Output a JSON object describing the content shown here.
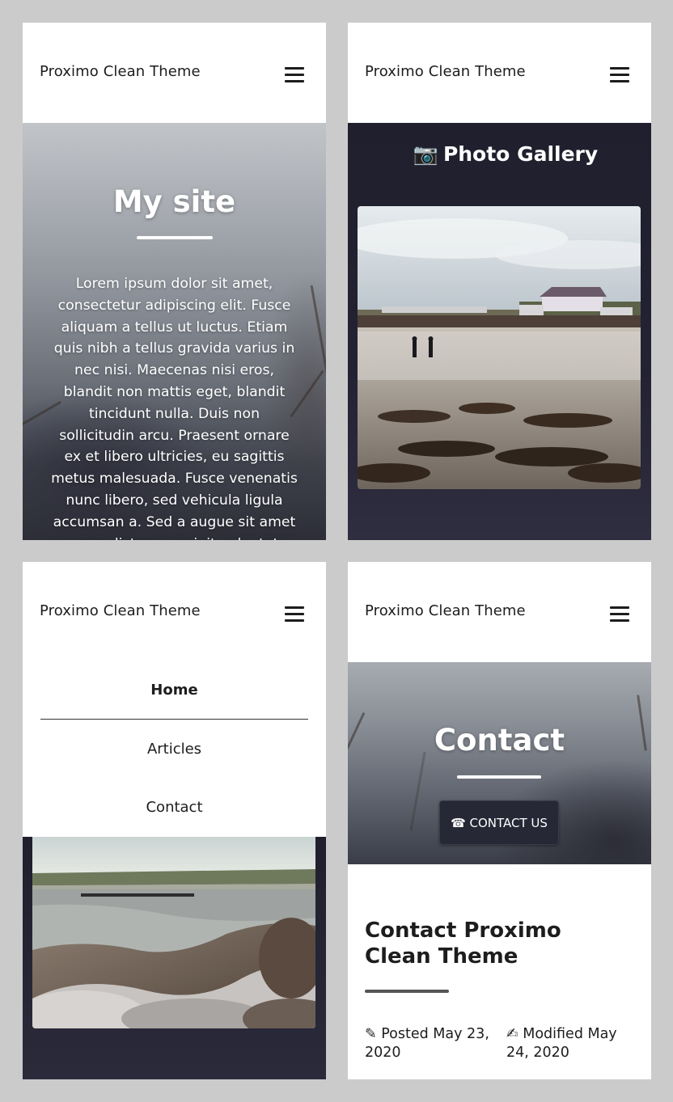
{
  "brand": "Proximo Clean Theme",
  "hero": {
    "title": "My site",
    "body": "Lorem ipsum dolor sit amet, consectetur adipiscing elit. Fusce aliquam a tellus ut luctus. Etiam quis nibh a tellus gravida varius in nec nisi. Maecenas nisi eros, blandit non mattis eget, blandit tincidunt nulla. Duis non sollicitudin arcu. Praesent ornare ex et libero ultricies, eu sagittis metus malesuada. Fusce venenatis nunc libero, sed vehicula ligula accumsan a. Sed a augue sit amet neque dictum suscipit vulputate"
  },
  "gallery": {
    "icon": "camera-icon",
    "camera_glyph": "📷",
    "title": "Photo Gallery"
  },
  "nav": {
    "items": [
      {
        "label": "Home",
        "active": true
      },
      {
        "label": "Articles",
        "active": false
      },
      {
        "label": "Contact",
        "active": false
      }
    ]
  },
  "contact": {
    "title": "Contact",
    "button_icon": "telephone-icon",
    "button_glyph": "☎",
    "button_label": "CONTACT US"
  },
  "article": {
    "title": "Contact Proximo Clean Theme",
    "posted_icon": "pencil-icon",
    "posted_glyph": "✎",
    "posted": "Posted May 23, 2020",
    "modified_icon": "writing-hand-icon",
    "modified_glyph": "✍",
    "modified": "Modified May 24, 2020"
  },
  "colors": {
    "page_bg": "#cbcbcb",
    "header_bg": "#ffffff",
    "gallery_bg": "#1f1f2d",
    "button_bg": "#272836",
    "text": "#1d1d1d"
  }
}
